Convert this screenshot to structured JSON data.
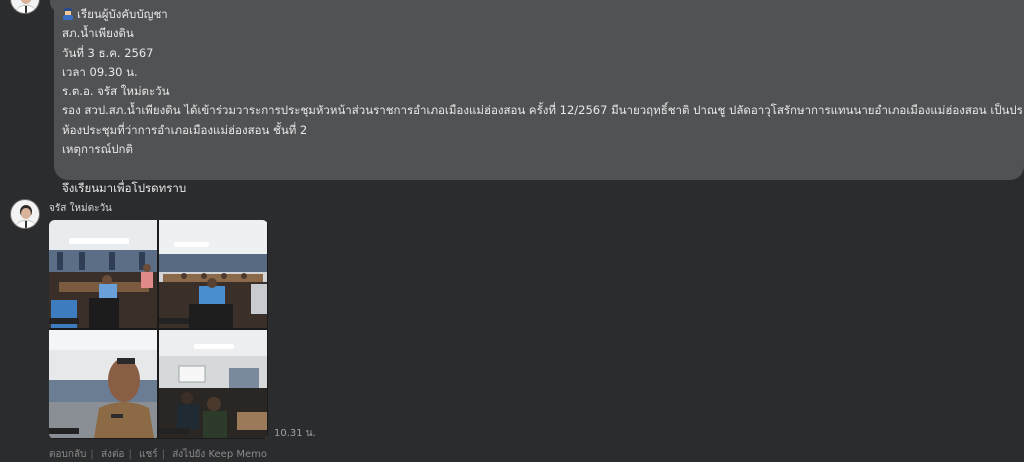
{
  "message": {
    "lines": [
      "เรียนผู้บังคับบัญชา",
      "สภ.น้ำเพียงดิน",
      "วันที่ 3 ธ.ค. 2567",
      "เวลา  09.30 น.",
      "ร.ต.อ. จรัส   ใหม่ตะวัน",
      "รอง สวป.สภ.น้ำเพียงดิน  ได้เข้าร่วมวาระการประชุมหัวหน้าส่วนราชการอำเภอเมืองแม่ฮ่องสอน  ครั้งที่ 12/2567  มีนายวฤทธิ์ชาติ  ปาณชู  ปลัดอาวุโสรักษาการแทนนายอำเภอเมืองแม่ฮ่องสอน เป็นประธาน  ณ",
      "ห้องประชุมที่ว่าการอำเภอเมืองแม่ฮ่องสอน ชั้นที่ 2",
      "เหตุการณ์ปกติ",
      "",
      "จึงเรียนมาเพื่อโปรดทราบ"
    ]
  },
  "sender": {
    "name": "จรัส ใหม่ตะวัน"
  },
  "timestamp": "10.31 น.",
  "actions": {
    "reply": "ตอบกลับ",
    "forward": "ส่งต่อ",
    "share": "แชร์",
    "keep_memo": "ส่งไปยัง Keep Memo"
  }
}
